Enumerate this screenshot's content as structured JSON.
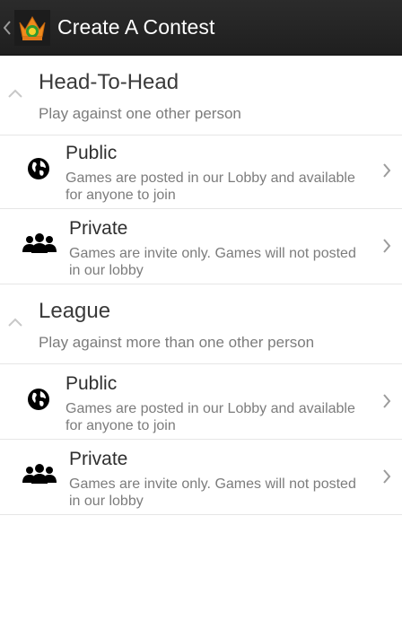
{
  "actionbar": {
    "title": "Create A Contest",
    "up_icon": "chevron-left-icon",
    "logo_icon": "crown-logo-icon"
  },
  "sections": [
    {
      "title": "Head-To-Head",
      "subtitle": "Play against one other person",
      "items": [
        {
          "title": "Public",
          "description": "Games are posted in our Lobby and available for anyone to join",
          "icon": "globe-icon"
        },
        {
          "title": "Private",
          "description": "Games are invite only. Games will not posted in our lobby",
          "icon": "group-icon"
        }
      ]
    },
    {
      "title": "League",
      "subtitle": "Play against more than one other person",
      "items": [
        {
          "title": "Public",
          "description": "Games are posted in our Lobby and available for anyone to join",
          "icon": "globe-icon"
        },
        {
          "title": "Private",
          "description": "Games are invite only. Games will not posted in our lobby",
          "icon": "group-icon"
        }
      ]
    }
  ],
  "colors": {
    "actionbar_bg": "#222222",
    "divider": "#e6e6e6",
    "secondary_text": "#7c7c7c",
    "primary_text": "#2f2f2f"
  }
}
